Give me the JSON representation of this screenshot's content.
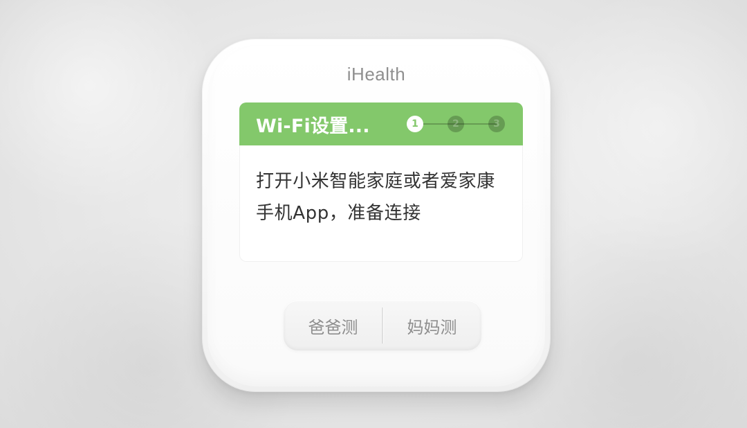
{
  "device": {
    "brand": "iHealth"
  },
  "screen": {
    "title": "Wi-Fi设置...",
    "header_color": "#83c86b",
    "steps": [
      {
        "label": "1",
        "state": "active"
      },
      {
        "label": "2",
        "state": "inactive"
      },
      {
        "label": "3",
        "state": "inactive"
      }
    ],
    "message_lines": [
      "打开小米智能家庭或者爱家康",
      "手机App，准备连接"
    ]
  },
  "buttons": {
    "left_label": "爸爸测",
    "right_label": "妈妈测"
  },
  "colors": {
    "button_text": "#8e8e8e",
    "brand_text": "#8f8f8f",
    "body_text": "#333333"
  }
}
